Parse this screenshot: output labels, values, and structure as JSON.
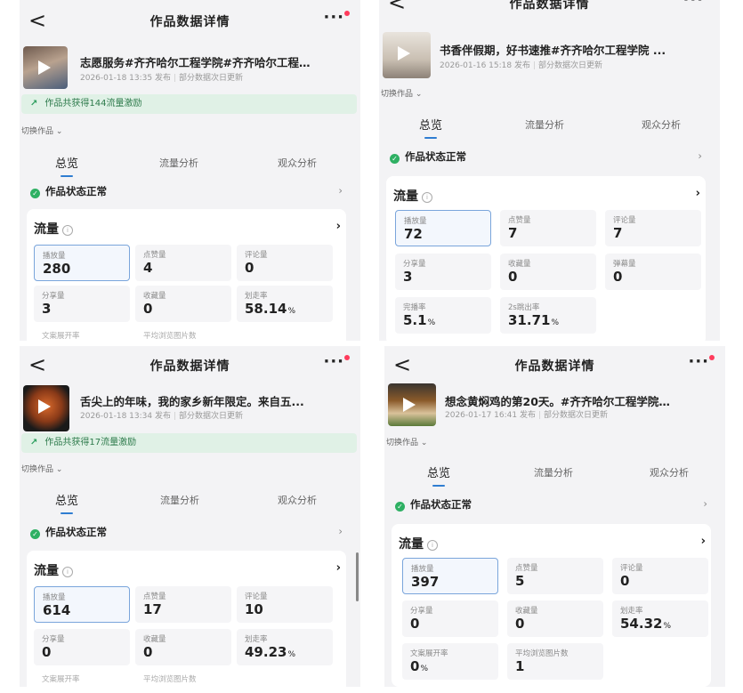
{
  "screens": [
    {
      "header_title": "作品数据详情",
      "more_label": "···",
      "work_title": "志愿服务#齐齐哈尔工程学院#齐齐哈尔工程…",
      "publish_time": "2026-01-18 13:35 发布",
      "update_note": "部分数据次日更新",
      "boost_text": "作品共获得144流量激励",
      "switch_label": "切换作品",
      "tabs": [
        "总览",
        "流量分析",
        "观众分析"
      ],
      "status_text": "作品状态正常",
      "flow_title": "流量",
      "metrics": [
        {
          "label": "播放量",
          "value": "280"
        },
        {
          "label": "点赞量",
          "value": "4"
        },
        {
          "label": "评论量",
          "value": "0"
        },
        {
          "label": "分享量",
          "value": "3"
        },
        {
          "label": "收藏量",
          "value": "0"
        },
        {
          "label": "划走率",
          "value": "58.14",
          "unit": "%"
        }
      ],
      "faded_labels": [
        "文案展开率",
        "平均浏览图片数"
      ]
    },
    {
      "header_title": "作品数据详情",
      "more_label": "···",
      "work_title": "书香伴假期，好书速推#齐齐哈尔工程学院 ...",
      "publish_time": "2026-01-16 15:18 发布",
      "update_note": "部分数据次日更新",
      "switch_label": "切换作品",
      "tabs": [
        "总览",
        "流量分析",
        "观众分析"
      ],
      "status_text": "作品状态正常",
      "flow_title": "流量",
      "metrics": [
        {
          "label": "播放量",
          "value": "72"
        },
        {
          "label": "点赞量",
          "value": "7"
        },
        {
          "label": "评论量",
          "value": "7"
        },
        {
          "label": "分享量",
          "value": "3"
        },
        {
          "label": "收藏量",
          "value": "0"
        },
        {
          "label": "弹幕量",
          "value": "0"
        },
        {
          "label": "完播率",
          "value": "5.1",
          "unit": "%"
        },
        {
          "label": "2s跳出率",
          "value": "31.71",
          "unit": "%"
        }
      ]
    },
    {
      "header_title": "作品数据详情",
      "more_label": "···",
      "work_title": "舌尖上的年味，我的家乡新年限定。来自五...",
      "publish_time": "2026-01-18 13:34 发布",
      "update_note": "部分数据次日更新",
      "boost_text": "作品共获得17流量激励",
      "switch_label": "切换作品",
      "tabs": [
        "总览",
        "流量分析",
        "观众分析"
      ],
      "status_text": "作品状态正常",
      "flow_title": "流量",
      "metrics": [
        {
          "label": "播放量",
          "value": "614"
        },
        {
          "label": "点赞量",
          "value": "17"
        },
        {
          "label": "评论量",
          "value": "10"
        },
        {
          "label": "分享量",
          "value": "0"
        },
        {
          "label": "收藏量",
          "value": "0"
        },
        {
          "label": "划走率",
          "value": "49.23",
          "unit": "%"
        }
      ],
      "faded_labels": [
        "文案展开率",
        "平均浏览图片数"
      ]
    },
    {
      "header_title": "作品数据详情",
      "more_label": "···",
      "work_title": "想念黄焖鸡的第20天。#齐齐哈尔工程学院…",
      "publish_time": "2026-01-17 16:41 发布",
      "update_note": "部分数据次日更新",
      "switch_label": "切换作品",
      "tabs": [
        "总览",
        "流量分析",
        "观众分析"
      ],
      "status_text": "作品状态正常",
      "flow_title": "流量",
      "metrics": [
        {
          "label": "播放量",
          "value": "397"
        },
        {
          "label": "点赞量",
          "value": "5"
        },
        {
          "label": "评论量",
          "value": "0"
        },
        {
          "label": "分享量",
          "value": "0"
        },
        {
          "label": "收藏量",
          "value": "0"
        },
        {
          "label": "划走率",
          "value": "54.32",
          "unit": "%"
        },
        {
          "label": "文案展开率",
          "value": "0",
          "unit": "%"
        },
        {
          "label": "平均浏览图片数",
          "value": "1"
        }
      ]
    }
  ],
  "colors": {
    "accent_blue": "#2f7dd1",
    "status_green": "#2eb063",
    "boost_bg": "#e0f1e6",
    "notification_dot": "#ff3b5c"
  },
  "icons": [
    "back-arrow-icon",
    "more-icon",
    "play-icon",
    "trend-up-icon",
    "check-circle-icon",
    "info-icon",
    "chevron-right-icon",
    "chevron-down-icon"
  ]
}
